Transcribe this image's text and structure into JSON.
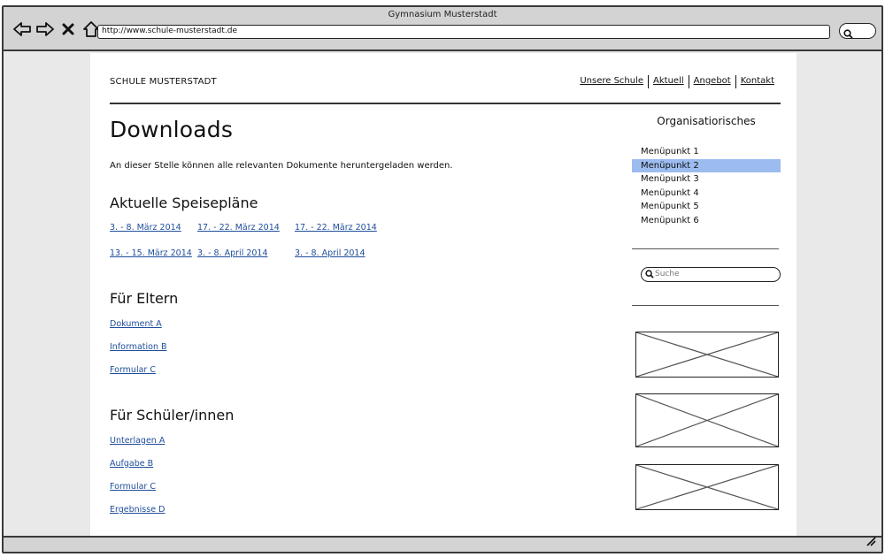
{
  "browser": {
    "window_title": "Gymnasium Musterstadt",
    "url": "http://www.schule-musterstadt.de"
  },
  "site": {
    "name": "SCHULE MUSTERSTADT",
    "nav": [
      "Unsere Schule",
      "Aktuell",
      "Angebot",
      "Kontakt"
    ]
  },
  "main": {
    "title": "Downloads",
    "intro": "An dieser Stelle können alle relevanten Dokumente heruntergeladen werden.",
    "speiseplaene": {
      "heading": "Aktuelle Speisepläne",
      "links": [
        "3. - 8. März 2014",
        "17. - 22. März 2014",
        "17. - 22. März 2014",
        "13. - 15. März 2014",
        "3. - 8. April 2014",
        "3. - 8. April 2014"
      ]
    },
    "eltern": {
      "heading": "Für Eltern",
      "links": [
        "Dokument A",
        "Information B",
        "Formular C"
      ]
    },
    "schueler": {
      "heading": "Für Schüler/innen",
      "links": [
        "Unterlagen A",
        "Aufgabe B",
        "Formular C",
        "Ergebnisse D"
      ]
    }
  },
  "sidebar": {
    "title": "Organisatiorisches",
    "menu": [
      "Menüpunkt 1",
      "Menüpunkt 2",
      "Menüpunkt 3",
      "Menüpunkt 4",
      "Menüpunkt 5",
      "Menüpunkt 6"
    ],
    "active_index": 1,
    "search_placeholder": "Suche"
  },
  "icons": {
    "back": "arrow-left-icon",
    "forward": "arrow-right-icon",
    "stop": "close-icon",
    "home": "home-icon",
    "search": "search-icon",
    "resize": "resize-grip-icon"
  },
  "colors": {
    "link": "#1f4e9c",
    "menu_active": "#9cbcf0"
  }
}
